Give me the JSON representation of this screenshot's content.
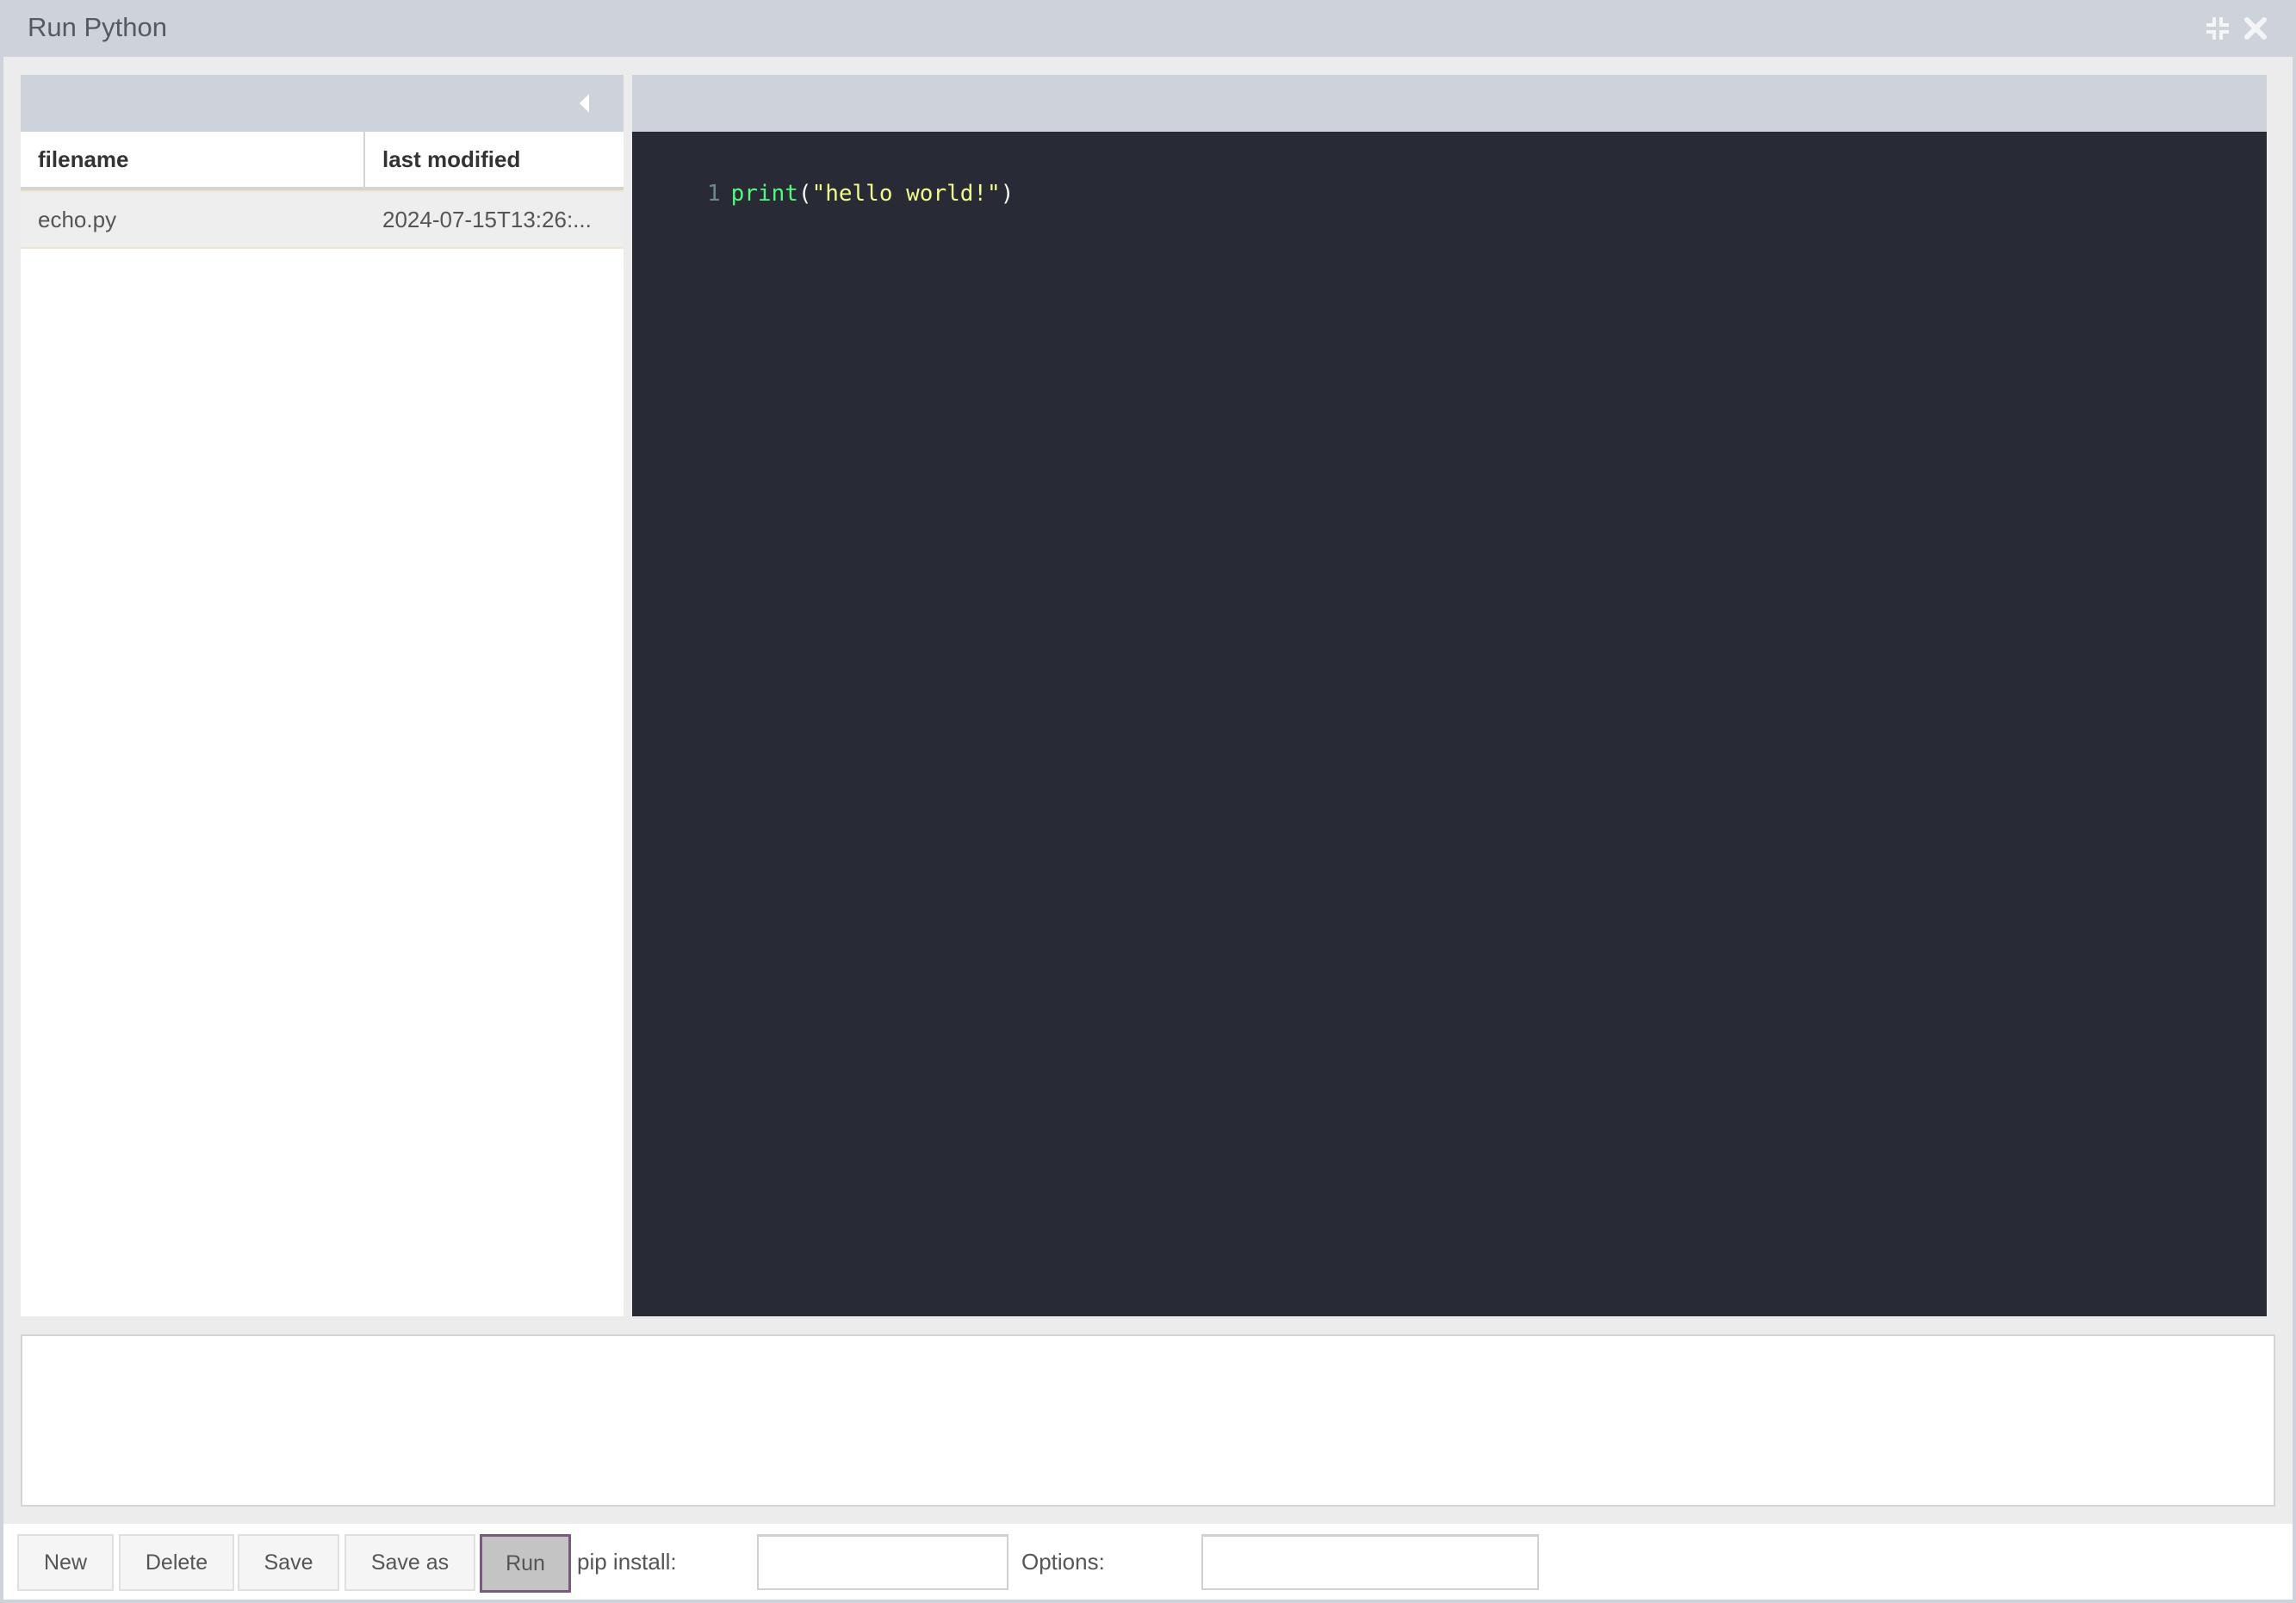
{
  "window": {
    "title": "Run Python",
    "controls": [
      {
        "name": "minimize-icon",
        "glyph": "compress"
      },
      {
        "name": "close-icon",
        "glyph": "×"
      }
    ]
  },
  "file_list": {
    "columns": [
      "filename",
      "last modified"
    ],
    "rows": [
      {
        "filename": "echo.py",
        "last_modified": "2024-07-15T13:26:..."
      }
    ]
  },
  "editor": {
    "lines": [
      {
        "number": "1",
        "tokens": [
          {
            "type": "fn",
            "text": "print"
          },
          {
            "type": "punc",
            "text": "("
          },
          {
            "type": "str",
            "text": "\"hello world!\""
          },
          {
            "type": "punc",
            "text": ")"
          }
        ]
      }
    ]
  },
  "output": {
    "text": ""
  },
  "toolbar": {
    "new_label": "New",
    "delete_label": "Delete",
    "save_label": "Save",
    "save_as_label": "Save as",
    "run_label": "Run",
    "pip_label": "pip install:",
    "pip_value": "",
    "options_label": "Options:",
    "options_value": ""
  },
  "colors": {
    "titlebar": "#ced2da",
    "editor_bg": "#282a36",
    "run_border": "#7a5a7e"
  }
}
